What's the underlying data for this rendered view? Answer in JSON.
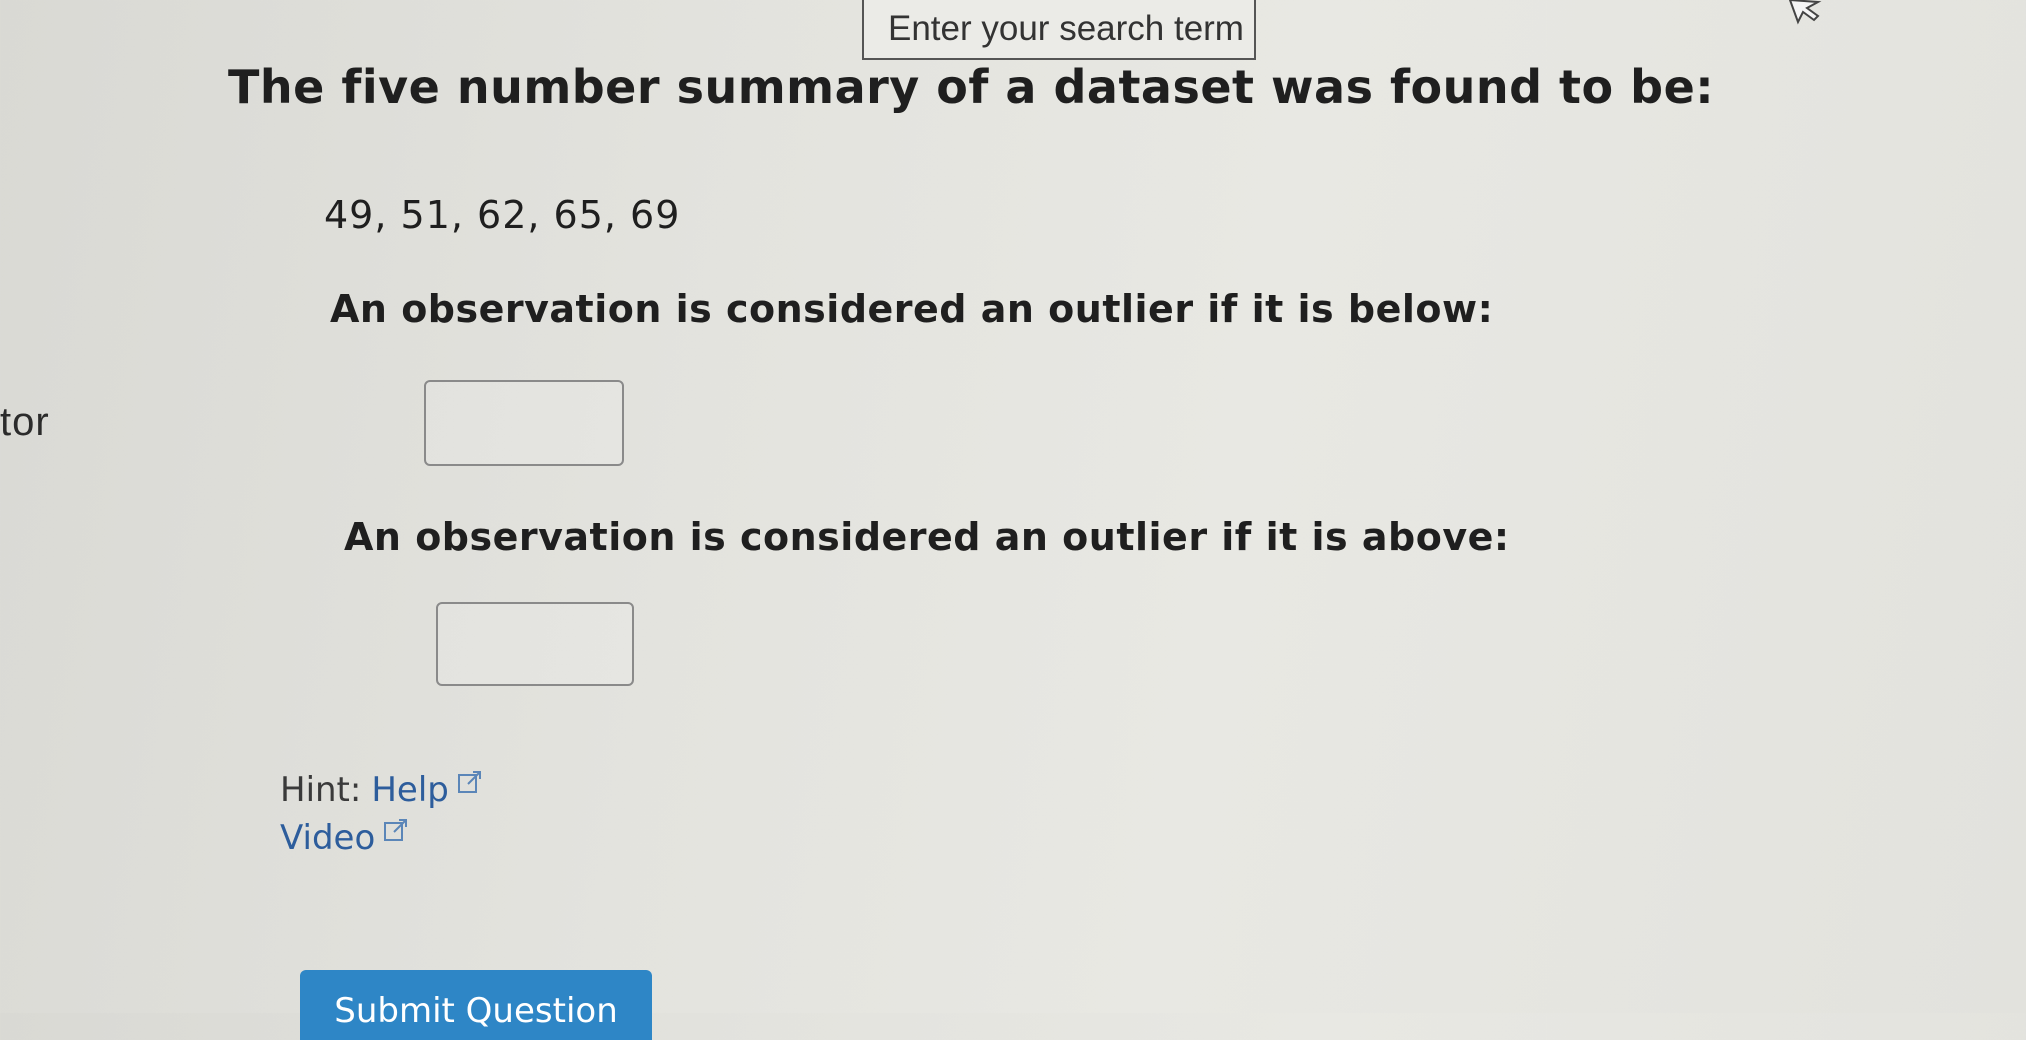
{
  "search": {
    "placeholder": "Enter your search term"
  },
  "sidebar": {
    "fragment_text": "tor"
  },
  "question": {
    "title": "The five number summary of a dataset was found to be:",
    "values": "49, 51, 62, 65, 69",
    "prompt_below": "An observation is considered an outlier if it is below:",
    "input_below_value": "",
    "prompt_above": "An observation is considered an outlier if it is above:",
    "input_above_value": ""
  },
  "hint": {
    "prefix": "Hint:",
    "help_label": "Help",
    "video_label": "Video"
  },
  "submit": {
    "label": "Submit Question",
    "color": "#2e86c6"
  },
  "icons": {
    "external_link": "external-link-icon",
    "cursor": "mouse-pointer-icon"
  },
  "colors": {
    "link": "#2d5d9c",
    "text": "#1f1f1f"
  }
}
